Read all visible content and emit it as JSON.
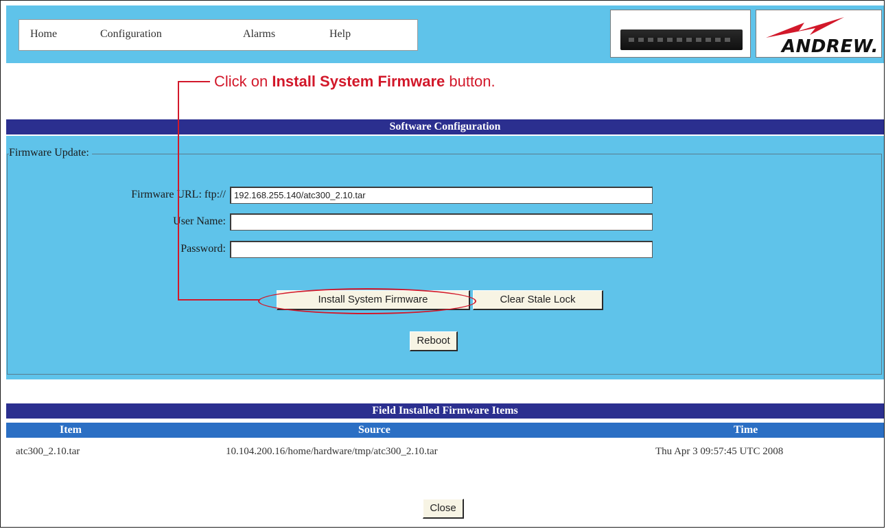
{
  "nav": {
    "items": [
      {
        "label": "Home"
      },
      {
        "label": "Configuration"
      },
      {
        "label": "Alarms"
      },
      {
        "label": "Help"
      }
    ]
  },
  "brand": {
    "logo_text": "ANDREW."
  },
  "annotation": {
    "prefix": "Click on ",
    "emphasis": "Install System Firmware",
    "suffix": " button."
  },
  "software_config": {
    "title": "Software Configuration",
    "legend": "Firmware Update:",
    "url_label": "Firmware URL: ftp://",
    "url_value": "192.168.255.140/atc300_2.10.tar",
    "user_label": "User Name:",
    "user_value": "",
    "password_label": "Password:",
    "password_value": "",
    "install_button": "Install System Firmware",
    "clear_button": "Clear Stale Lock",
    "reboot_button": "Reboot"
  },
  "firmware_items": {
    "title": "Field Installed Firmware Items",
    "columns": [
      "Item",
      "Source",
      "Time"
    ],
    "rows": [
      {
        "item": "atc300_2.10.tar",
        "source": "10.104.200.16/home/hardware/tmp/atc300_2.10.tar",
        "time": "Thu Apr 3 09:57:45 UTC 2008"
      }
    ]
  },
  "close_button": "Close",
  "colors": {
    "panel": "#5fc3ea",
    "section_bar": "#2b2f8f",
    "column_bar": "#2b6fc4",
    "annotation": "#d2182a"
  }
}
